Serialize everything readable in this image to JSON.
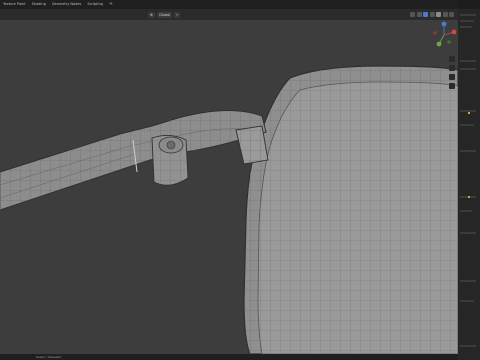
{
  "workspace_tabs": [
    "Texture Paint",
    "Shading",
    "Geometry Nodes",
    "Scripting"
  ],
  "viewport_header": {
    "pivot_label": "Global",
    "snap_label": ""
  },
  "statusbar": {
    "hint": "Select / Deselect"
  },
  "colors": {
    "viewport_bg": "#3d3d3d",
    "mesh_face": "#8f8f8f",
    "mesh_wire": "#6a6a6a",
    "gizmo_x": "#d6453f",
    "gizmo_y": "#6ea83d",
    "gizmo_z": "#4a7bd1"
  },
  "icons": [
    "plus-icon",
    "transform-pivot-icon",
    "snap-icon",
    "overlay-icon",
    "xray-icon",
    "shading-icon",
    "zoom-icon",
    "hand-icon",
    "camera-icon",
    "grid-icon"
  ]
}
